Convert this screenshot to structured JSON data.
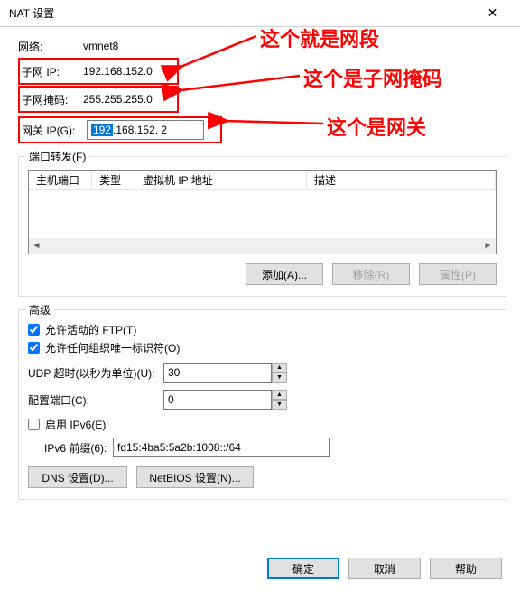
{
  "window": {
    "title": "NAT 设置",
    "close": "✕"
  },
  "network": {
    "label": "网络:",
    "value": "vmnet8",
    "subnet_ip_label": "子网 IP:",
    "subnet_ip_value": "192.168.152.0",
    "mask_label": "子网掩码:",
    "mask_value": "255.255.255.0",
    "gateway_label": "网关 IP(G):",
    "gateway_oct1": "192",
    "gateway_rest": ".168.152. 2"
  },
  "annotations": {
    "a1": "这个就是网段",
    "a2": "这个是子网掩码",
    "a3": "这个是网关"
  },
  "port_fwd": {
    "group": "端口转发(F)",
    "col_host": "主机端口",
    "col_type": "类型",
    "col_vm": "虚拟机 IP 地址",
    "col_desc": "描述",
    "add": "添加(A)...",
    "remove": "移除(R)",
    "prop": "属性(P)"
  },
  "advanced": {
    "group": "高级",
    "ftp": "允许活动的 FTP(T)",
    "oui": "允许任何组织唯一标识符(O)",
    "udp_label": "UDP 超时(以秒为单位)(U):",
    "udp_value": "30",
    "cfg_label": "配置端口(C):",
    "cfg_value": "0",
    "ipv6_label": "启用 IPv6(E)",
    "prefix_label": "IPv6 前缀(6):",
    "prefix_value": "fd15:4ba5:5a2b:1008::/64",
    "dns": "DNS 设置(D)...",
    "netbios": "NetBIOS 设置(N)..."
  },
  "footer": {
    "ok": "确定",
    "cancel": "取消",
    "help": "帮助"
  }
}
